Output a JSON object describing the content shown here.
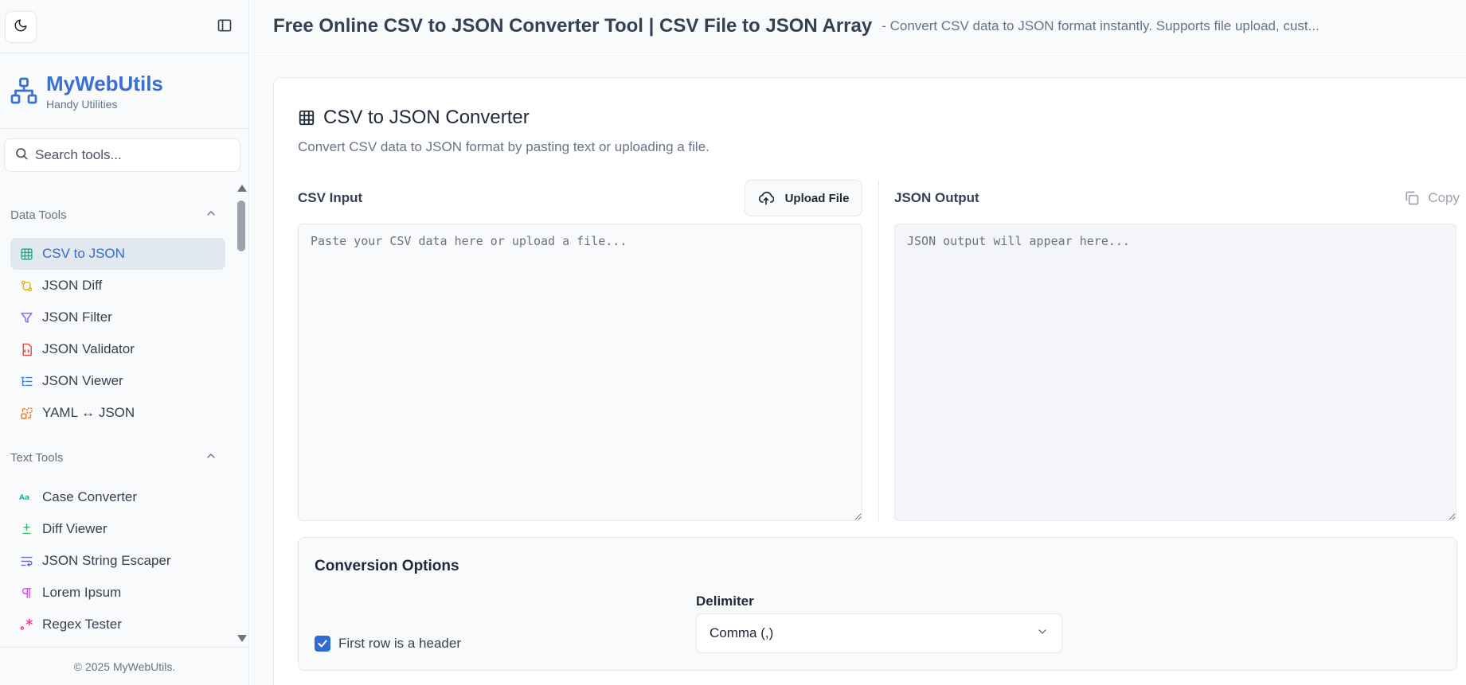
{
  "sidebar": {
    "brand": {
      "name": "MyWebUtils",
      "tagline": "Handy Utilities"
    },
    "search": {
      "placeholder": "Search tools..."
    },
    "groups": [
      {
        "title": "Data Tools",
        "items": [
          {
            "label": "CSV to JSON",
            "icon": "table-icon",
            "color": "#10b981",
            "active": true
          },
          {
            "label": "JSON Diff",
            "icon": "diff-icon",
            "color": "#eab308"
          },
          {
            "label": "JSON Filter",
            "icon": "filter-icon",
            "color": "#8b5cf6"
          },
          {
            "label": "JSON Validator",
            "icon": "file-code-icon",
            "color": "#ef4444"
          },
          {
            "label": "JSON Viewer",
            "icon": "list-tree-icon",
            "color": "#3b82f6"
          },
          {
            "label": "YAML ↔ JSON",
            "icon": "convert-icon",
            "color": "#f97316"
          }
        ]
      },
      {
        "title": "Text Tools",
        "items": [
          {
            "label": "Case Converter",
            "icon": "case-icon",
            "color": "#14b8a6"
          },
          {
            "label": "Diff Viewer",
            "icon": "plus-minus-icon",
            "color": "#22c55e"
          },
          {
            "label": "JSON String Escaper",
            "icon": "wrap-text-icon",
            "color": "#6366f1"
          },
          {
            "label": "Lorem Ipsum",
            "icon": "pilcrow-icon",
            "color": "#d946ef"
          },
          {
            "label": "Regex Tester",
            "icon": "regex-icon",
            "color": "#ec4899"
          }
        ]
      }
    ],
    "copyright": "© 2025 MyWebUtils."
  },
  "header": {
    "title": "Free Online CSV to JSON Converter Tool | CSV File to JSON Array",
    "description": "- Convert CSV data to JSON format instantly. Supports file upload, cust..."
  },
  "tool": {
    "title": "CSV to JSON Converter",
    "subtitle": "Convert CSV data to JSON format by pasting text or uploading a file.",
    "input": {
      "label": "CSV Input",
      "upload_label": "Upload File",
      "placeholder": "Paste your CSV data here or upload a file...",
      "value": ""
    },
    "output": {
      "label": "JSON Output",
      "copy_label": "Copy",
      "placeholder": "JSON output will appear here...",
      "value": ""
    },
    "options": {
      "title": "Conversion Options",
      "header_checkbox_label": "First row is a header",
      "header_checked": true,
      "delimiter_label": "Delimiter",
      "delimiter_value": "Comma (,)"
    }
  },
  "colors": {
    "accent": "#2f6bd0",
    "brand": "#3b6fd4"
  }
}
